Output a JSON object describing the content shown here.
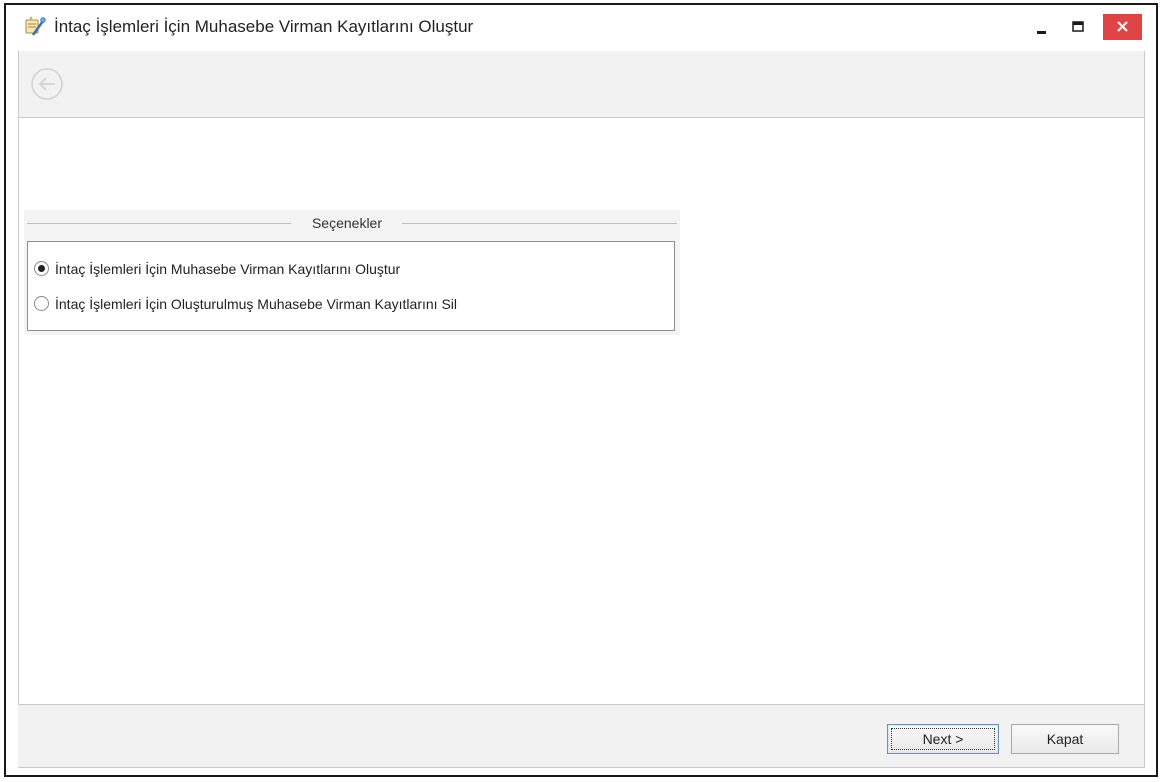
{
  "window": {
    "title": "İntaç İşlemleri İçin Muhasebe Virman Kayıtlarını Oluştur",
    "icon": "wizard-icon",
    "close_color": "#e04343"
  },
  "options": {
    "group_title": "Seçenekler",
    "items": [
      {
        "label": "İntaç İşlemleri İçin Muhasebe Virman Kayıtlarını Oluştur",
        "selected": true
      },
      {
        "label": "İntaç İşlemleri İçin Oluşturulmuş Muhasebe Virman Kayıtlarını Sil",
        "selected": false
      }
    ]
  },
  "footer": {
    "next_label": "Next >",
    "close_label": "Kapat"
  }
}
